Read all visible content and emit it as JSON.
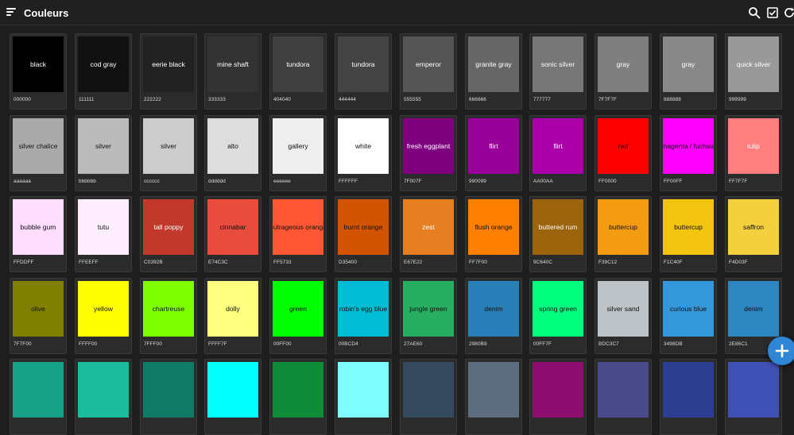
{
  "app": {
    "title": "Couleurs"
  },
  "icons": {
    "menu": "menu-icon",
    "search": "search-icon",
    "select_all": "checkbox-icon",
    "refresh": "refresh-icon",
    "add": "plus-icon"
  },
  "accent": "#2F86D6",
  "colors": [
    {
      "name": "black",
      "hex": "000000",
      "color": "#000000",
      "text": "#ffffff"
    },
    {
      "name": "cod gray",
      "hex": "111111",
      "color": "#111111",
      "text": "#ffffff"
    },
    {
      "name": "eerie black",
      "hex": "222222",
      "color": "#222222",
      "text": "#ffffff"
    },
    {
      "name": "mine shaft",
      "hex": "333333",
      "color": "#333333",
      "text": "#ffffff"
    },
    {
      "name": "tundora",
      "hex": "404040",
      "color": "#404040",
      "text": "#ffffff"
    },
    {
      "name": "tundora",
      "hex": "444444",
      "color": "#444444",
      "text": "#ffffff"
    },
    {
      "name": "emperor",
      "hex": "555555",
      "color": "#555555",
      "text": "#ffffff"
    },
    {
      "name": "granite gray",
      "hex": "666666",
      "color": "#666666",
      "text": "#ffffff"
    },
    {
      "name": "sonic silver",
      "hex": "777777",
      "color": "#777777",
      "text": "#ffffff"
    },
    {
      "name": "gray",
      "hex": "7F7F7F",
      "color": "#7F7F7F",
      "text": "#ffffff"
    },
    {
      "name": "gray",
      "hex": "888888",
      "color": "#888888",
      "text": "#ffffff"
    },
    {
      "name": "quick silver",
      "hex": "999999",
      "color": "#999999",
      "text": "#ffffff"
    },
    {
      "name": "silver chalice",
      "hex": "aaaaaa",
      "color": "#aaaaaa",
      "text": "#111111"
    },
    {
      "name": "silver",
      "hex": "bbbbbb",
      "color": "#bbbbbb",
      "text": "#111111"
    },
    {
      "name": "silver",
      "hex": "cccccc",
      "color": "#cccccc",
      "text": "#111111"
    },
    {
      "name": "alto",
      "hex": "dddddd",
      "color": "#dddddd",
      "text": "#111111"
    },
    {
      "name": "gallery",
      "hex": "eeeeee",
      "color": "#eeeeee",
      "text": "#111111"
    },
    {
      "name": "white",
      "hex": "FFFFFF",
      "color": "#FFFFFF",
      "text": "#111111"
    },
    {
      "name": "fresh eggplant",
      "hex": "7F007F",
      "color": "#7F007F",
      "text": "#ffffff"
    },
    {
      "name": "flirt",
      "hex": "990099",
      "color": "#990099",
      "text": "#ffffff"
    },
    {
      "name": "flirt",
      "hex": "AA00AA",
      "color": "#AA00AA",
      "text": "#ffffff"
    },
    {
      "name": "red",
      "hex": "FF0000",
      "color": "#FF0000",
      "text": "#111111"
    },
    {
      "name": "magenta / fuchsia",
      "hex": "FF00FF",
      "color": "#FF00FF",
      "text": "#111111"
    },
    {
      "name": "tulip",
      "hex": "FF7F7F",
      "color": "#FF7F7F",
      "text": "#ffffff"
    },
    {
      "name": "bubble gum",
      "hex": "FFDDFF",
      "color": "#FFDDFF",
      "text": "#111111"
    },
    {
      "name": "tutu",
      "hex": "FFEEFF",
      "color": "#FFEEFF",
      "text": "#111111"
    },
    {
      "name": "tall poppy",
      "hex": "C0392B",
      "color": "#C0392B",
      "text": "#ffffff"
    },
    {
      "name": "cinnabar",
      "hex": "E74C3C",
      "color": "#E74C3C",
      "text": "#111111"
    },
    {
      "name": "outrageous orange",
      "hex": "FF5733",
      "color": "#FF5733",
      "text": "#111111"
    },
    {
      "name": "burnt orange",
      "hex": "D35400",
      "color": "#D35400",
      "text": "#111111"
    },
    {
      "name": "zest",
      "hex": "E67E22",
      "color": "#E67E22",
      "text": "#ffffff"
    },
    {
      "name": "flush orange",
      "hex": "FF7F00",
      "color": "#FF7F00",
      "text": "#111111"
    },
    {
      "name": "buttered rum",
      "hex": "9C640C",
      "color": "#9C640C",
      "text": "#ffffff"
    },
    {
      "name": "buttercup",
      "hex": "F39C12",
      "color": "#F39C12",
      "text": "#111111"
    },
    {
      "name": "buttercup",
      "hex": "F1C40F",
      "color": "#F1C40F",
      "text": "#111111"
    },
    {
      "name": "saffron",
      "hex": "F4D03F",
      "color": "#F4D03F",
      "text": "#111111"
    },
    {
      "name": "olive",
      "hex": "7F7F00",
      "color": "#7F7F00",
      "text": "#111111"
    },
    {
      "name": "yellow",
      "hex": "FFFF00",
      "color": "#FFFF00",
      "text": "#111111"
    },
    {
      "name": "chartreuse",
      "hex": "7FFF00",
      "color": "#7FFF00",
      "text": "#111111"
    },
    {
      "name": "dolly",
      "hex": "FFFF7F",
      "color": "#FFFF7F",
      "text": "#111111"
    },
    {
      "name": "green",
      "hex": "00FF00",
      "color": "#00FF00",
      "text": "#111111"
    },
    {
      "name": "robin's egg blue",
      "hex": "00BCD4",
      "color": "#00BCD4",
      "text": "#111111"
    },
    {
      "name": "jungle green",
      "hex": "27AE60",
      "color": "#27AE60",
      "text": "#111111"
    },
    {
      "name": "denim",
      "hex": "2980B9",
      "color": "#2980B9",
      "text": "#111111"
    },
    {
      "name": "spring green",
      "hex": "00FF7F",
      "color": "#00FF7F",
      "text": "#111111"
    },
    {
      "name": "silver sand",
      "hex": "BDC3C7",
      "color": "#BDC3C7",
      "text": "#111111"
    },
    {
      "name": "curious blue",
      "hex": "3498DB",
      "color": "#3498DB",
      "text": "#111111"
    },
    {
      "name": "denim",
      "hex": "2E86C1",
      "color": "#2E86C1",
      "text": "#111111"
    },
    {
      "name": "",
      "hex": "",
      "color": "#16A085",
      "text": "#111111"
    },
    {
      "name": "",
      "hex": "",
      "color": "#1ABC9C",
      "text": "#111111"
    },
    {
      "name": "",
      "hex": "",
      "color": "#117A65",
      "text": "#111111"
    },
    {
      "name": "",
      "hex": "",
      "color": "#00FFFF",
      "text": "#111111"
    },
    {
      "name": "",
      "hex": "",
      "color": "#0F8C3A",
      "text": "#111111"
    },
    {
      "name": "",
      "hex": "",
      "color": "#7FFFFF",
      "text": "#111111"
    },
    {
      "name": "",
      "hex": "",
      "color": "#34495E",
      "text": "#111111"
    },
    {
      "name": "",
      "hex": "",
      "color": "#5D6D7E",
      "text": "#111111"
    },
    {
      "name": "",
      "hex": "",
      "color": "#8E0E6F",
      "text": "#111111"
    },
    {
      "name": "",
      "hex": "",
      "color": "#4A4A8A",
      "text": "#111111"
    },
    {
      "name": "",
      "hex": "",
      "color": "#2C3E8F",
      "text": "#111111"
    },
    {
      "name": "",
      "hex": "",
      "color": "#3F51B5",
      "text": "#111111"
    }
  ]
}
